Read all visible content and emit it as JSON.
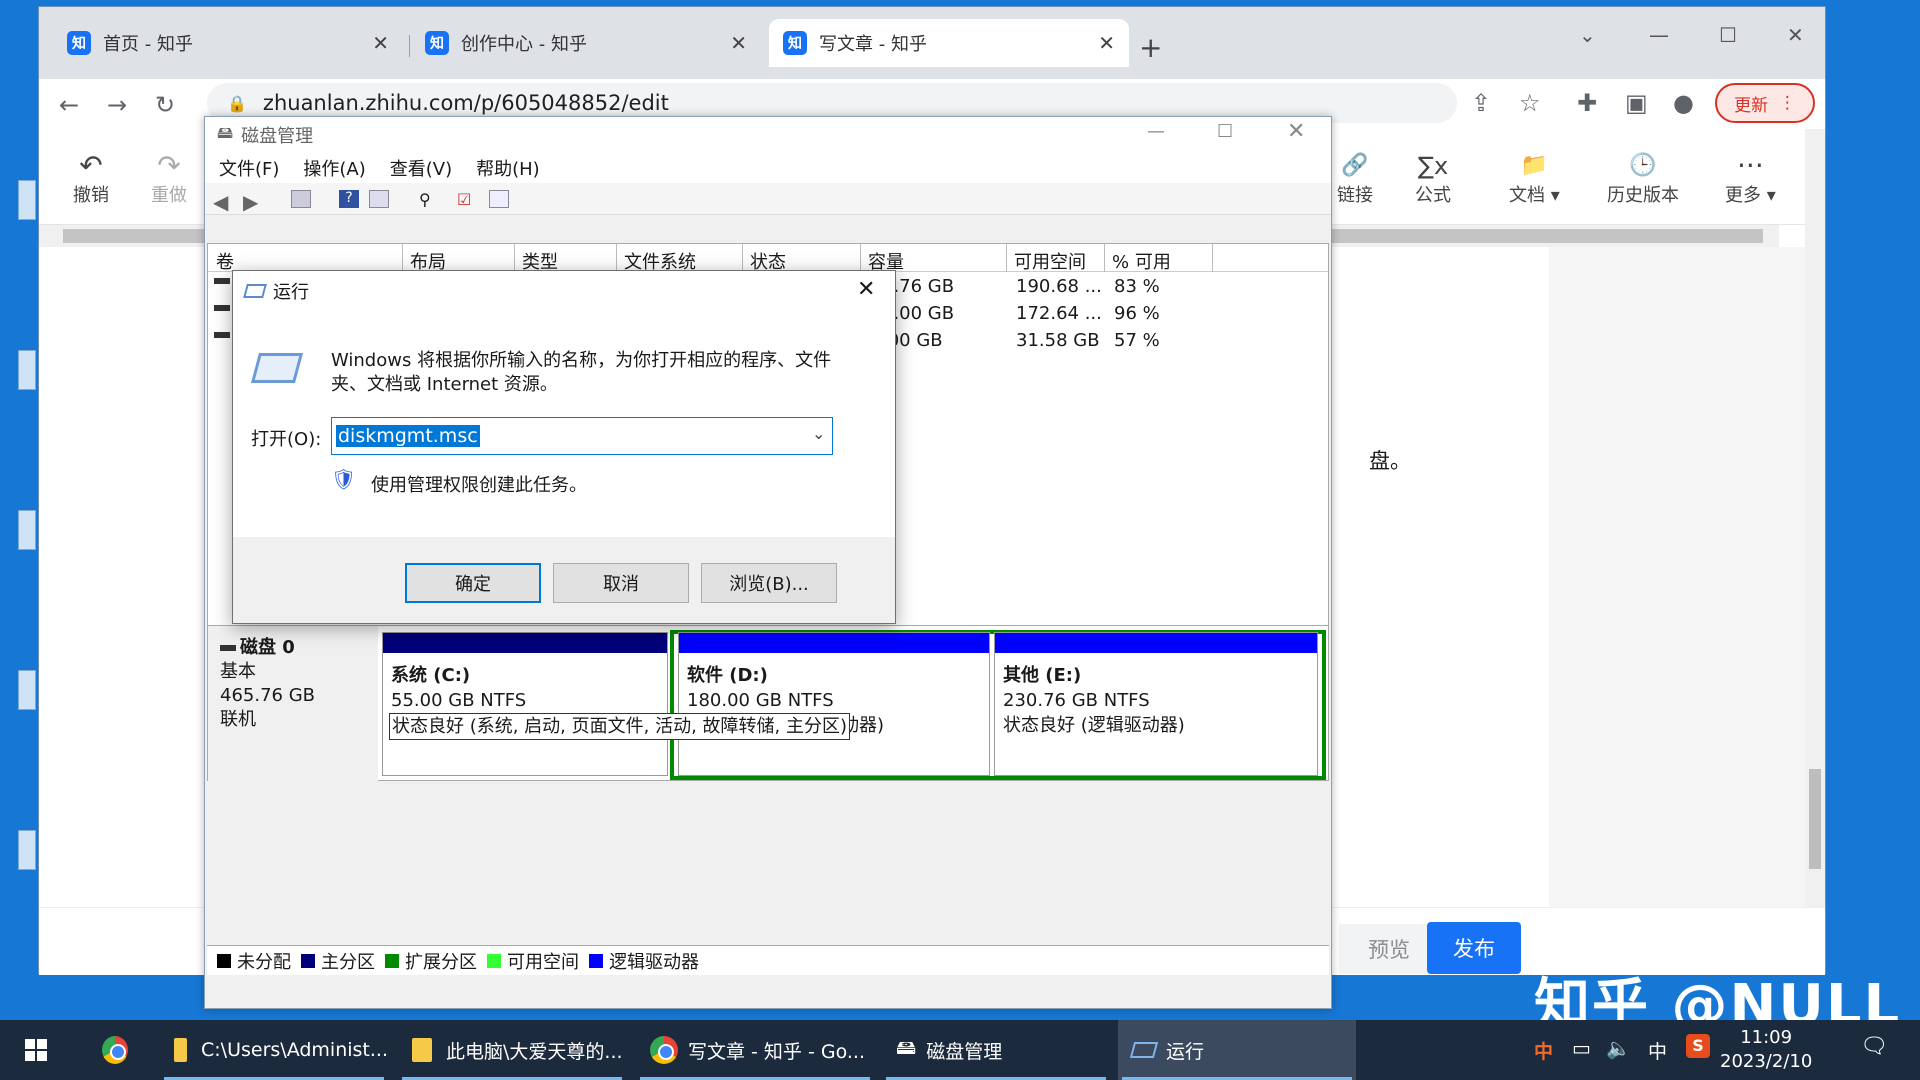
{
  "browser": {
    "tabs": [
      {
        "label": "首页 - 知乎",
        "icon": "知"
      },
      {
        "label": "创作中心 - 知乎",
        "icon": "知"
      },
      {
        "label": "写文章 - 知乎",
        "icon": "知"
      }
    ],
    "url": "zhuanlan.zhihu.com/p/605048852/edit",
    "update_label": "更新"
  },
  "editor": {
    "tools_left": [
      {
        "label": "撤销",
        "glyph": "↶"
      },
      {
        "label": "重做",
        "glyph": "↷"
      }
    ],
    "tools_right": [
      {
        "label": "链接",
        "glyph": "🔗"
      },
      {
        "label": "公式",
        "glyph": "∑x"
      },
      {
        "label": "文档 ▾",
        "glyph": "📁"
      },
      {
        "label": "历史版本",
        "glyph": "🕒"
      },
      {
        "label": "更多 ▾",
        "glyph": "···"
      }
    ],
    "visible_text": "盘。",
    "preview_label": "预览",
    "publish_label": "发布"
  },
  "disk_mgmt": {
    "title": "磁盘管理",
    "menu": [
      "文件(F)",
      "操作(A)",
      "查看(V)",
      "帮助(H)"
    ],
    "columns": [
      "卷",
      "布局",
      "类型",
      "文件系统",
      "状态",
      "容量",
      "可用空间",
      "% 可用"
    ],
    "rows": [
      {
        "capacity": "0.76 GB",
        "free": "190.68 ...",
        "pct": "83 %"
      },
      {
        "capacity": "0.00 GB",
        "free": "172.64 ...",
        "pct": "96 %"
      },
      {
        "capacity": ".00 GB",
        "free": "31.58 GB",
        "pct": "57 %"
      }
    ],
    "disk": {
      "name": "磁盘 0",
      "type": "基本",
      "size": "465.76 GB",
      "status": "联机"
    },
    "partitions": [
      {
        "name": "系统 (C:)",
        "fs": "55.00 GB NTFS",
        "status": "状态良好 (系统, 启动, 页面文件, 活动, 故障转储, 主分区)"
      },
      {
        "name": "软件 (D:)",
        "fs": "180.00 GB NTFS",
        "status": "动器)"
      },
      {
        "name": "其他 (E:)",
        "fs": "230.76 GB NTFS",
        "status": "状态良好 (逻辑驱动器)"
      }
    ],
    "legend": [
      {
        "label": "未分配",
        "color": "#000000"
      },
      {
        "label": "主分区",
        "color": "#00007a"
      },
      {
        "label": "扩展分区",
        "color": "#008a00"
      },
      {
        "label": "可用空间",
        "color": "#33ff33"
      },
      {
        "label": "逻辑驱动器",
        "color": "#0000ff"
      }
    ]
  },
  "run_dialog": {
    "title": "运行",
    "description": "Windows 将根据你所输入的名称，为你打开相应的程序、文件夹、文档或 Internet 资源。",
    "open_label": "打开(O):",
    "command": "diskmgmt.msc",
    "admin_text": "使用管理权限创建此任务。",
    "ok": "确定",
    "cancel": "取消",
    "browse": "浏览(B)..."
  },
  "taskbar": {
    "items": [
      {
        "label": "C:\\Users\\Administ..."
      },
      {
        "label": "此电脑\\大爱天尊的..."
      },
      {
        "label": "写文章 - 知乎 - Go..."
      },
      {
        "label": "磁盘管理"
      },
      {
        "label": "运行"
      }
    ],
    "ime": "中",
    "ime2": "中",
    "time": "11:09",
    "date": "2023/2/10"
  },
  "watermark": "知乎 @NULL"
}
